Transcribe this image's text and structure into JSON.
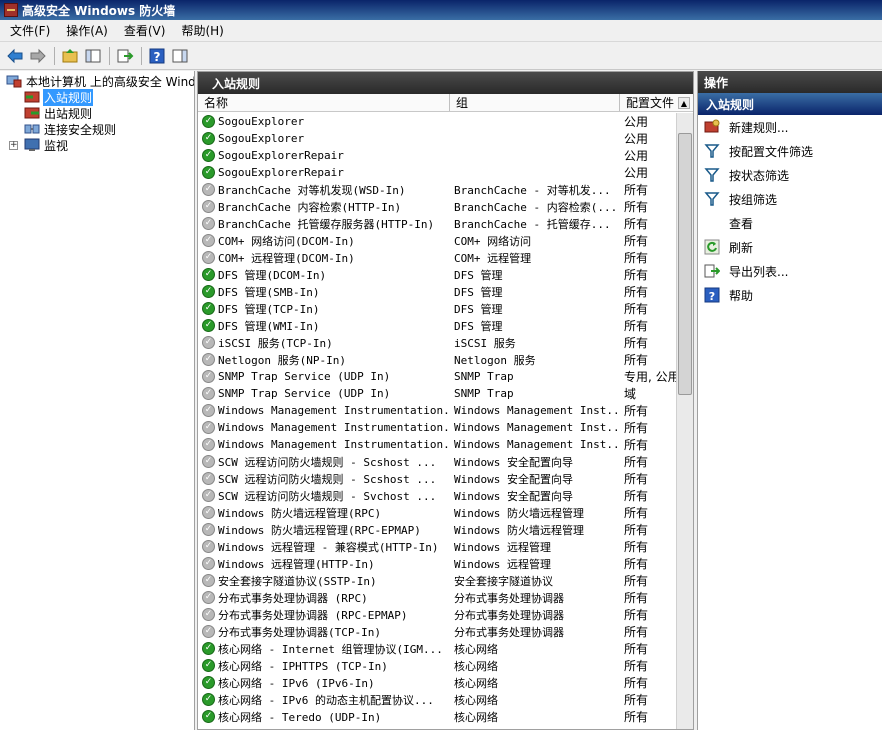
{
  "window": {
    "title": "高级安全 Windows 防火墙"
  },
  "menu": [
    "文件(F)",
    "操作(A)",
    "查看(V)",
    "帮助(H)"
  ],
  "tree": {
    "root": "本地计算机 上的高级安全 Windows 防火墙",
    "items": [
      "入站规则",
      "出站规则",
      "连接安全规则",
      "监视"
    ]
  },
  "center": {
    "header": "入站规则",
    "columns": {
      "name": "名称",
      "group": "组",
      "profile": "配置文件"
    },
    "rows": [
      {
        "enabled": true,
        "name": "SogouExplorer",
        "group": "",
        "profile": "公用"
      },
      {
        "enabled": true,
        "name": "SogouExplorer",
        "group": "",
        "profile": "公用"
      },
      {
        "enabled": true,
        "name": "SogouExplorerRepair",
        "group": "",
        "profile": "公用"
      },
      {
        "enabled": true,
        "name": "SogouExplorerRepair",
        "group": "",
        "profile": "公用"
      },
      {
        "enabled": false,
        "name": "BranchCache 对等机发现(WSD-In)",
        "group": "BranchCache - 对等机发...",
        "profile": "所有"
      },
      {
        "enabled": false,
        "name": "BranchCache 内容检索(HTTP-In)",
        "group": "BranchCache - 内容检索(...",
        "profile": "所有"
      },
      {
        "enabled": false,
        "name": "BranchCache 托管缓存服务器(HTTP-In)",
        "group": "BranchCache - 托管缓存...",
        "profile": "所有"
      },
      {
        "enabled": false,
        "name": "COM+ 网络访问(DCOM-In)",
        "group": "COM+ 网络访问",
        "profile": "所有"
      },
      {
        "enabled": false,
        "name": "COM+ 远程管理(DCOM-In)",
        "group": "COM+ 远程管理",
        "profile": "所有"
      },
      {
        "enabled": true,
        "name": "DFS 管理(DCOM-In)",
        "group": "DFS 管理",
        "profile": "所有"
      },
      {
        "enabled": true,
        "name": "DFS 管理(SMB-In)",
        "group": "DFS 管理",
        "profile": "所有"
      },
      {
        "enabled": true,
        "name": "DFS 管理(TCP-In)",
        "group": "DFS 管理",
        "profile": "所有"
      },
      {
        "enabled": true,
        "name": "DFS 管理(WMI-In)",
        "group": "DFS 管理",
        "profile": "所有"
      },
      {
        "enabled": false,
        "name": "iSCSI 服务(TCP-In)",
        "group": "iSCSI 服务",
        "profile": "所有"
      },
      {
        "enabled": false,
        "name": "Netlogon 服务(NP-In)",
        "group": "Netlogon 服务",
        "profile": "所有"
      },
      {
        "enabled": false,
        "name": "SNMP Trap Service (UDP In)",
        "group": "SNMP Trap",
        "profile": "专用, 公用"
      },
      {
        "enabled": false,
        "name": "SNMP Trap Service (UDP In)",
        "group": "SNMP Trap",
        "profile": "域"
      },
      {
        "enabled": false,
        "name": "Windows Management Instrumentation...",
        "group": "Windows Management Inst...",
        "profile": "所有"
      },
      {
        "enabled": false,
        "name": "Windows Management Instrumentation...",
        "group": "Windows Management Inst...",
        "profile": "所有"
      },
      {
        "enabled": false,
        "name": "Windows Management Instrumentation...",
        "group": "Windows Management Inst...",
        "profile": "所有"
      },
      {
        "enabled": false,
        "name": "SCW 远程访问防火墙规则 - Scshost ...",
        "group": "Windows 安全配置向导",
        "profile": "所有"
      },
      {
        "enabled": false,
        "name": "SCW 远程访问防火墙规则 - Scshost ...",
        "group": "Windows 安全配置向导",
        "profile": "所有"
      },
      {
        "enabled": false,
        "name": "SCW 远程访问防火墙规则 - Svchost ...",
        "group": "Windows 安全配置向导",
        "profile": "所有"
      },
      {
        "enabled": false,
        "name": "Windows 防火墙远程管理(RPC)",
        "group": "Windows 防火墙远程管理",
        "profile": "所有"
      },
      {
        "enabled": false,
        "name": "Windows 防火墙远程管理(RPC-EPMAP)",
        "group": "Windows 防火墙远程管理",
        "profile": "所有"
      },
      {
        "enabled": false,
        "name": "Windows 远程管理 - 兼容模式(HTTP-In)",
        "group": "Windows 远程管理",
        "profile": "所有"
      },
      {
        "enabled": false,
        "name": "Windows 远程管理(HTTP-In)",
        "group": "Windows 远程管理",
        "profile": "所有"
      },
      {
        "enabled": false,
        "name": "安全套接字隧道协议(SSTP-In)",
        "group": "安全套接字隧道协议",
        "profile": "所有"
      },
      {
        "enabled": false,
        "name": "分布式事务处理协调器 (RPC)",
        "group": "分布式事务处理协调器",
        "profile": "所有"
      },
      {
        "enabled": false,
        "name": "分布式事务处理协调器 (RPC-EPMAP)",
        "group": "分布式事务处理协调器",
        "profile": "所有"
      },
      {
        "enabled": false,
        "name": "分布式事务处理协调器(TCP-In)",
        "group": "分布式事务处理协调器",
        "profile": "所有"
      },
      {
        "enabled": true,
        "name": "核心网络 - Internet 组管理协议(IGM...",
        "group": "核心网络",
        "profile": "所有"
      },
      {
        "enabled": true,
        "name": "核心网络 - IPHTTPS (TCP-In)",
        "group": "核心网络",
        "profile": "所有"
      },
      {
        "enabled": true,
        "name": "核心网络 - IPv6 (IPv6-In)",
        "group": "核心网络",
        "profile": "所有"
      },
      {
        "enabled": true,
        "name": "核心网络 - IPv6 的动态主机配置协议...",
        "group": "核心网络",
        "profile": "所有"
      },
      {
        "enabled": true,
        "name": "核心网络 - Teredo (UDP-In)",
        "group": "核心网络",
        "profile": "所有"
      }
    ]
  },
  "actions": {
    "header": "操作",
    "section": "入站规则",
    "items": [
      {
        "label": "新建规则...",
        "icon": "new-rule-icon"
      },
      {
        "label": "按配置文件筛选",
        "icon": "filter-icon"
      },
      {
        "label": "按状态筛选",
        "icon": "filter-icon"
      },
      {
        "label": "按组筛选",
        "icon": "filter-icon"
      },
      {
        "label": "查看",
        "icon": ""
      },
      {
        "label": "刷新",
        "icon": "refresh-icon"
      },
      {
        "label": "导出列表...",
        "icon": "export-icon"
      },
      {
        "label": "帮助",
        "icon": "help-icon"
      }
    ]
  },
  "colors": {
    "enabled": "#2a9a2a",
    "disabled": "#b8b8b8",
    "selection": "#3399ff"
  }
}
